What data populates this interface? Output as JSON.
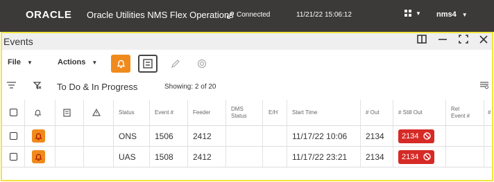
{
  "header": {
    "brand": "ORACLE",
    "subtitle": "Oracle Utilities NMS Flex Operations",
    "connection_status": "Connected",
    "datetime": "11/21/22 15:06:12",
    "user": "nms4"
  },
  "panel": {
    "title": "Events"
  },
  "toolbar": {
    "file_label": "File",
    "actions_label": "Actions"
  },
  "filterbar": {
    "filter_name": "To Do & In Progress",
    "showing": "Showing: 2 of 20"
  },
  "table": {
    "columns": [
      "Status",
      "Event #",
      "Feeder",
      "DMS\nStatus",
      "E/H",
      "Start Time",
      "# Out",
      "# Still Out",
      "Rel\nEvent #",
      "#"
    ],
    "rows": [
      {
        "status": "ONS",
        "event": "1506",
        "feeder": "2412",
        "dms_status": "",
        "eh": "",
        "start_time": "11/17/22 10:06",
        "out": "2134",
        "still_out": "2134",
        "rel_event": ""
      },
      {
        "status": "UAS",
        "event": "1508",
        "feeder": "2412",
        "dms_status": "",
        "eh": "",
        "start_time": "11/17/22 23:21",
        "out": "2134",
        "still_out": "2134",
        "rel_event": ""
      }
    ]
  },
  "colors": {
    "topbar": "#3b3a38",
    "accent_orange": "#f08a1c",
    "alert_red": "#d62a26",
    "panel_border": "#f2e43c"
  }
}
